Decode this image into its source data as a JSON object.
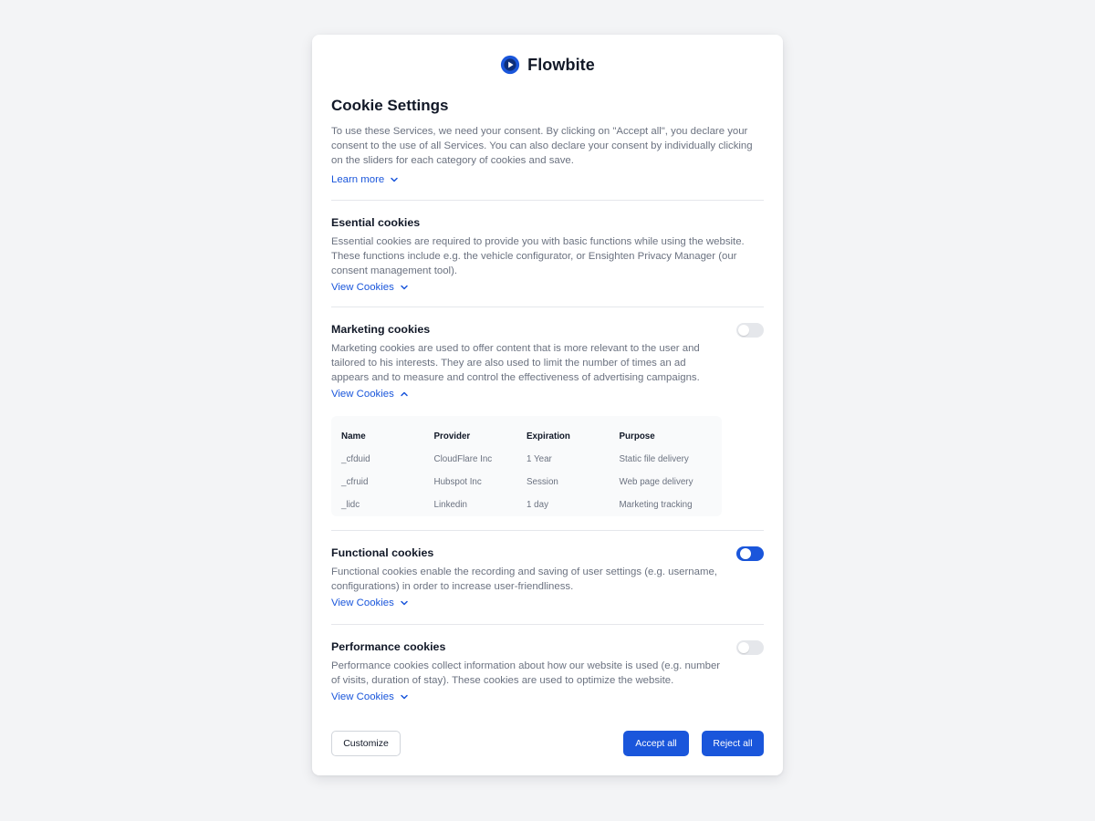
{
  "brand": {
    "name": "Flowbite",
    "logo_icon": "play-circle-icon",
    "color": "#1a56db"
  },
  "title": "Cookie Settings",
  "intro": "To use these Services, we need your consent. By clicking on \"Accept all\", you declare your consent to the use of all Services. You can also declare your consent by individually clicking on the sliders for each category of cookies and save.",
  "learn_more": "Learn more",
  "sections": [
    {
      "title": "Esential cookies",
      "description": "Essential cookies are required to provide you with basic functions while using the website. These functions include e.g. the vehicle configurator, or Ensighten Privacy Manager (our consent management tool).",
      "link": "View Cookies",
      "expanded": false
    },
    {
      "title": "Marketing cookies",
      "description": "Marketing cookies are used to offer content that is more relevant to the user and tailored to his interests. They are also used to limit the number of times an ad appears and to measure and control the effectiveness of advertising campaigns.",
      "link": "View Cookies",
      "expanded": true,
      "enabled": false
    },
    {
      "title": "Functional cookies",
      "description": "Functional cookies enable the recording and saving of user settings (e.g. username, configurations) in order to increase user-friendliness.",
      "link": "View Cookies",
      "expanded": false,
      "enabled": true
    },
    {
      "title": "Performance cookies",
      "description": "Performance cookies collect information about how our website is used (e.g. number of visits, duration of stay). These cookies are used to optimize the website.",
      "link": "View Cookies",
      "expanded": false,
      "enabled": false
    }
  ],
  "cookie_table": {
    "headers": [
      "Name",
      "Provider",
      "Expiration",
      "Purpose"
    ],
    "rows": [
      [
        "_cfduid",
        "CloudFlare Inc",
        "1 Year",
        "Static file delivery"
      ],
      [
        "_cfruid",
        "Hubspot Inc",
        "Session",
        "Web page delivery"
      ],
      [
        "_lidc",
        "Linkedin",
        "1 day",
        "Marketing tracking"
      ]
    ]
  },
  "buttons": {
    "customize": "Customize",
    "accept": "Accept all",
    "reject": "Reject all"
  }
}
